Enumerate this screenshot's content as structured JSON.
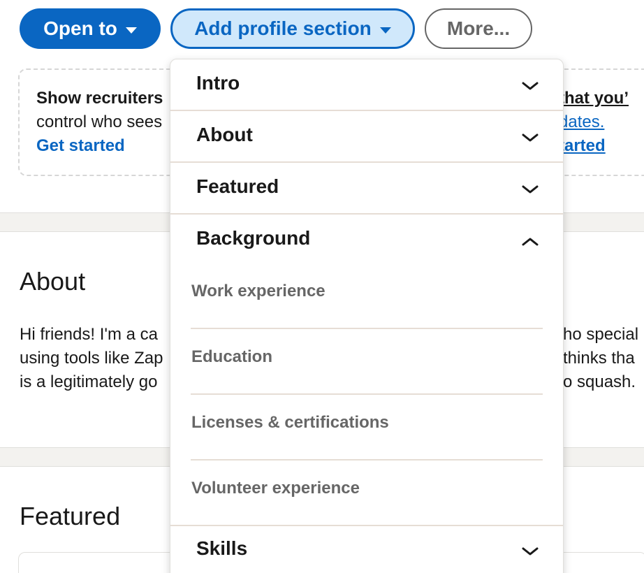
{
  "actions": {
    "open_to_label": "Open to",
    "add_section_label": "Add profile section",
    "more_label": "More..."
  },
  "recruiter_card": {
    "left_line1": "Show recruiters",
    "left_line2": "control who sees",
    "left_link": "Get started",
    "right_line1": "that you’",
    "right_line2": "dates.",
    "right_link": "tarted"
  },
  "about": {
    "title": "About",
    "line1": "Hi friends! I'm a ca",
    "line2": "using tools like Zap",
    "line3": "is a legitimately go",
    "line1_r": "ho special",
    "line2_r": "thinks tha",
    "line3_r": "o squash."
  },
  "featured": {
    "title": "Featured"
  },
  "dropdown": {
    "intro": "Intro",
    "about": "About",
    "featured": "Featured",
    "background": "Background",
    "background_items": [
      "Work experience",
      "Education",
      "Licenses & certifications",
      "Volunteer experience"
    ],
    "skills": "Skills"
  },
  "colors": {
    "primary": "#0a66c2",
    "primary_light": "#d0e8fb",
    "muted_text": "#666666",
    "divider": "#e6ddd5"
  }
}
